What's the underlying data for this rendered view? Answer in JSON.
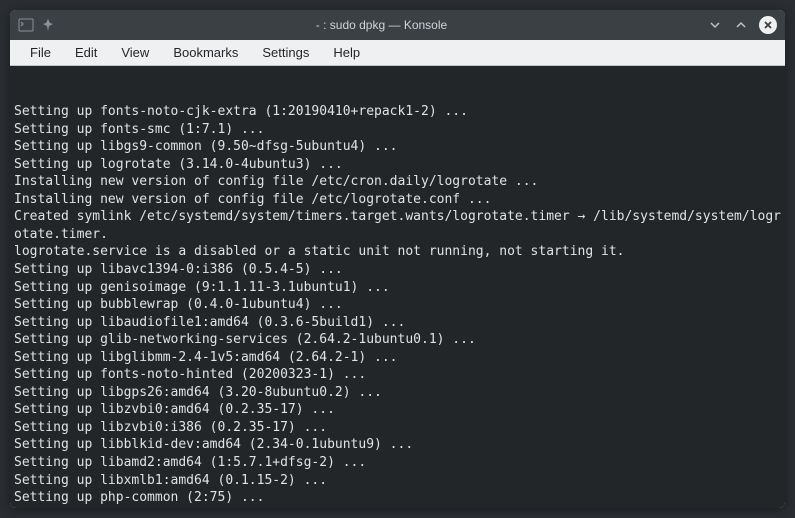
{
  "window": {
    "title": "- : sudo dpkg — Konsole"
  },
  "menubar": {
    "items": [
      "File",
      "Edit",
      "View",
      "Bookmarks",
      "Settings",
      "Help"
    ]
  },
  "terminal": {
    "lines": [
      "Setting up fonts-noto-cjk-extra (1:20190410+repack1-2) ...",
      "Setting up fonts-smc (1:7.1) ...",
      "Setting up libgs9-common (9.50~dfsg-5ubuntu4) ...",
      "Setting up logrotate (3.14.0-4ubuntu3) ...",
      "Installing new version of config file /etc/cron.daily/logrotate ...",
      "Installing new version of config file /etc/logrotate.conf ...",
      "Created symlink /etc/systemd/system/timers.target.wants/logrotate.timer → /lib/systemd/system/logrotate.timer.",
      "logrotate.service is a disabled or a static unit not running, not starting it.",
      "Setting up libavc1394-0:i386 (0.5.4-5) ...",
      "Setting up genisoimage (9:1.1.11-3.1ubuntu1) ...",
      "Setting up bubblewrap (0.4.0-1ubuntu4) ...",
      "Setting up libaudiofile1:amd64 (0.3.6-5build1) ...",
      "Setting up glib-networking-services (2.64.2-1ubuntu0.1) ...",
      "Setting up libglibmm-2.4-1v5:amd64 (2.64.2-1) ...",
      "Setting up fonts-noto-hinted (20200323-1) ...",
      "Setting up libgps26:amd64 (3.20-8ubuntu0.2) ...",
      "Setting up libzvbi0:amd64 (0.2.35-17) ...",
      "Setting up libzvbi0:i386 (0.2.35-17) ...",
      "Setting up libblkid-dev:amd64 (2.34-0.1ubuntu9) ...",
      "Setting up libamd2:amd64 (1:5.7.1+dfsg-2) ...",
      "Setting up libxmlb1:amd64 (0.1.15-2) ...",
      "Setting up php-common (2:75) ..."
    ]
  }
}
